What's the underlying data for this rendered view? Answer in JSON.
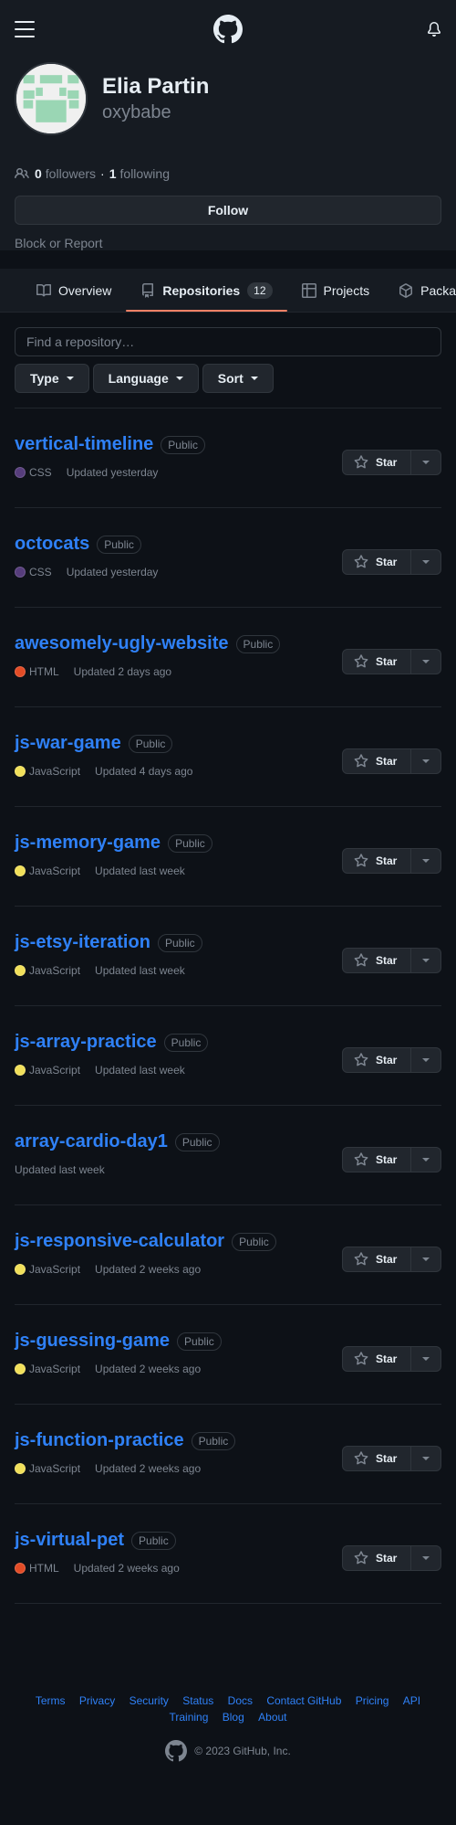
{
  "profile": {
    "full_name": "Elia Partin",
    "login": "oxybabe",
    "followers_count": "0",
    "followers_label": "followers",
    "following_count": "1",
    "following_label": "following",
    "separator": "·",
    "follow_label": "Follow",
    "block_report": "Block or Report"
  },
  "tabs": [
    {
      "label": "Overview",
      "icon": "book-icon"
    },
    {
      "label": "Repositories",
      "icon": "repo-icon",
      "counter": "12"
    },
    {
      "label": "Projects",
      "icon": "table-icon"
    },
    {
      "label": "Packages",
      "icon": "package-icon"
    }
  ],
  "search": {
    "placeholder": "Find a repository…"
  },
  "filters": [
    "Type",
    "Language",
    "Sort"
  ],
  "star_label": "Star",
  "repos": [
    {
      "name": "vertical-timeline",
      "visibility": "Public",
      "lang": "CSS",
      "color": "#563d7c",
      "updated": "Updated yesterday"
    },
    {
      "name": "octocats",
      "visibility": "Public",
      "lang": "CSS",
      "color": "#563d7c",
      "updated": "Updated yesterday"
    },
    {
      "name": "awesomely-ugly-website",
      "visibility": "Public",
      "lang": "HTML",
      "color": "#e34c26",
      "updated": "Updated 2 days ago"
    },
    {
      "name": "js-war-game",
      "visibility": "Public",
      "lang": "JavaScript",
      "color": "#f1e05a",
      "updated": "Updated 4 days ago"
    },
    {
      "name": "js-memory-game",
      "visibility": "Public",
      "lang": "JavaScript",
      "color": "#f1e05a",
      "updated": "Updated last week"
    },
    {
      "name": "js-etsy-iteration",
      "visibility": "Public",
      "lang": "JavaScript",
      "color": "#f1e05a",
      "updated": "Updated last week"
    },
    {
      "name": "js-array-practice",
      "visibility": "Public",
      "lang": "JavaScript",
      "color": "#f1e05a",
      "updated": "Updated last week"
    },
    {
      "name": "array-cardio-day1",
      "visibility": "Public",
      "lang": "",
      "color": "",
      "updated": "Updated last week"
    },
    {
      "name": "js-responsive-calculator",
      "visibility": "Public",
      "lang": "JavaScript",
      "color": "#f1e05a",
      "updated": "Updated 2 weeks ago"
    },
    {
      "name": "js-guessing-game",
      "visibility": "Public",
      "lang": "JavaScript",
      "color": "#f1e05a",
      "updated": "Updated 2 weeks ago"
    },
    {
      "name": "js-function-practice",
      "visibility": "Public",
      "lang": "JavaScript",
      "color": "#f1e05a",
      "updated": "Updated 2 weeks ago"
    },
    {
      "name": "js-virtual-pet",
      "visibility": "Public",
      "lang": "HTML",
      "color": "#e34c26",
      "updated": "Updated 2 weeks ago"
    }
  ],
  "footer": {
    "links": [
      "Terms",
      "Privacy",
      "Security",
      "Status",
      "Docs",
      "Contact GitHub",
      "Pricing",
      "API",
      "Training",
      "Blog",
      "About"
    ],
    "copyright": "© 2023 GitHub, Inc."
  }
}
